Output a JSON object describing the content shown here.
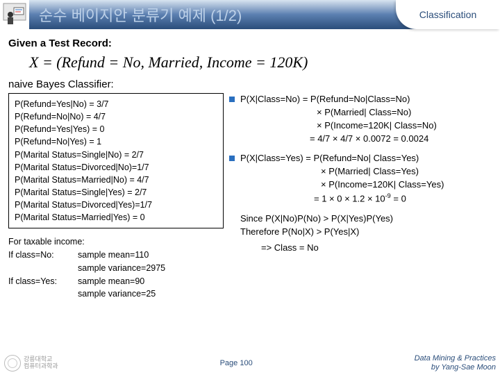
{
  "header": {
    "title": "순수 베이지안 분류기 예제 (1/2)",
    "right": "Classification"
  },
  "given": "Given a Test Record:",
  "testrecord": "X = (Refund = No, Married, Income = 120K)",
  "nbtitle": "naive Bayes Classifier:",
  "box": {
    "l1": "P(Refund=Yes|No) = 3/7",
    "l2": "P(Refund=No|No) = 4/7",
    "l3": "P(Refund=Yes|Yes) = 0",
    "l4": "P(Refund=No|Yes) = 1",
    "l5": "P(Marital Status=Single|No) = 2/7",
    "l6": "P(Marital Status=Divorced|No)=1/7",
    "l7": "P(Marital Status=Married|No) = 4/7",
    "l8": "P(Marital Status=Single|Yes) = 2/7",
    "l9": "P(Marital Status=Divorced|Yes)=1/7",
    "l10": "P(Marital Status=Married|Yes) = 0"
  },
  "tax": {
    "title": "For taxable income:",
    "no_label": "If class=No:",
    "no_mean": "sample mean=110",
    "no_var": "sample variance=2975",
    "yes_label": "If class=Yes:",
    "yes_mean": "sample mean=90",
    "yes_var": "sample variance=25"
  },
  "right": {
    "b1l1": "P(X|Class=No) = P(Refund=No|Class=No)",
    "b1l2": "× P(Married| Class=No)",
    "b1l3": "× P(Income=120K| Class=No)",
    "b1l4": "= 4/7 × 4/7 × 0.0072 = 0.0024",
    "b2l1": "P(X|Class=Yes) = P(Refund=No| Class=Yes)",
    "b2l2": "× P(Married| Class=Yes)",
    "b2l3": "× P(Income=120K| Class=Yes)",
    "b2l4a": "= 1 × 0 × 1.2 × 10",
    "b2l4b": "-9",
    "b2l4c": " = 0",
    "c1": "Since P(X|No)P(No) > P(X|Yes)P(Yes)",
    "c2": "Therefore P(No|X) > P(Yes|X)",
    "c3": "=> Class = No"
  },
  "footer": {
    "uni1": "강릉대학교",
    "uni2": "컴퓨터과학과",
    "page": "Page 100",
    "credit1": "Data Mining & Practices",
    "credit2": "by Yang-Sae Moon"
  }
}
